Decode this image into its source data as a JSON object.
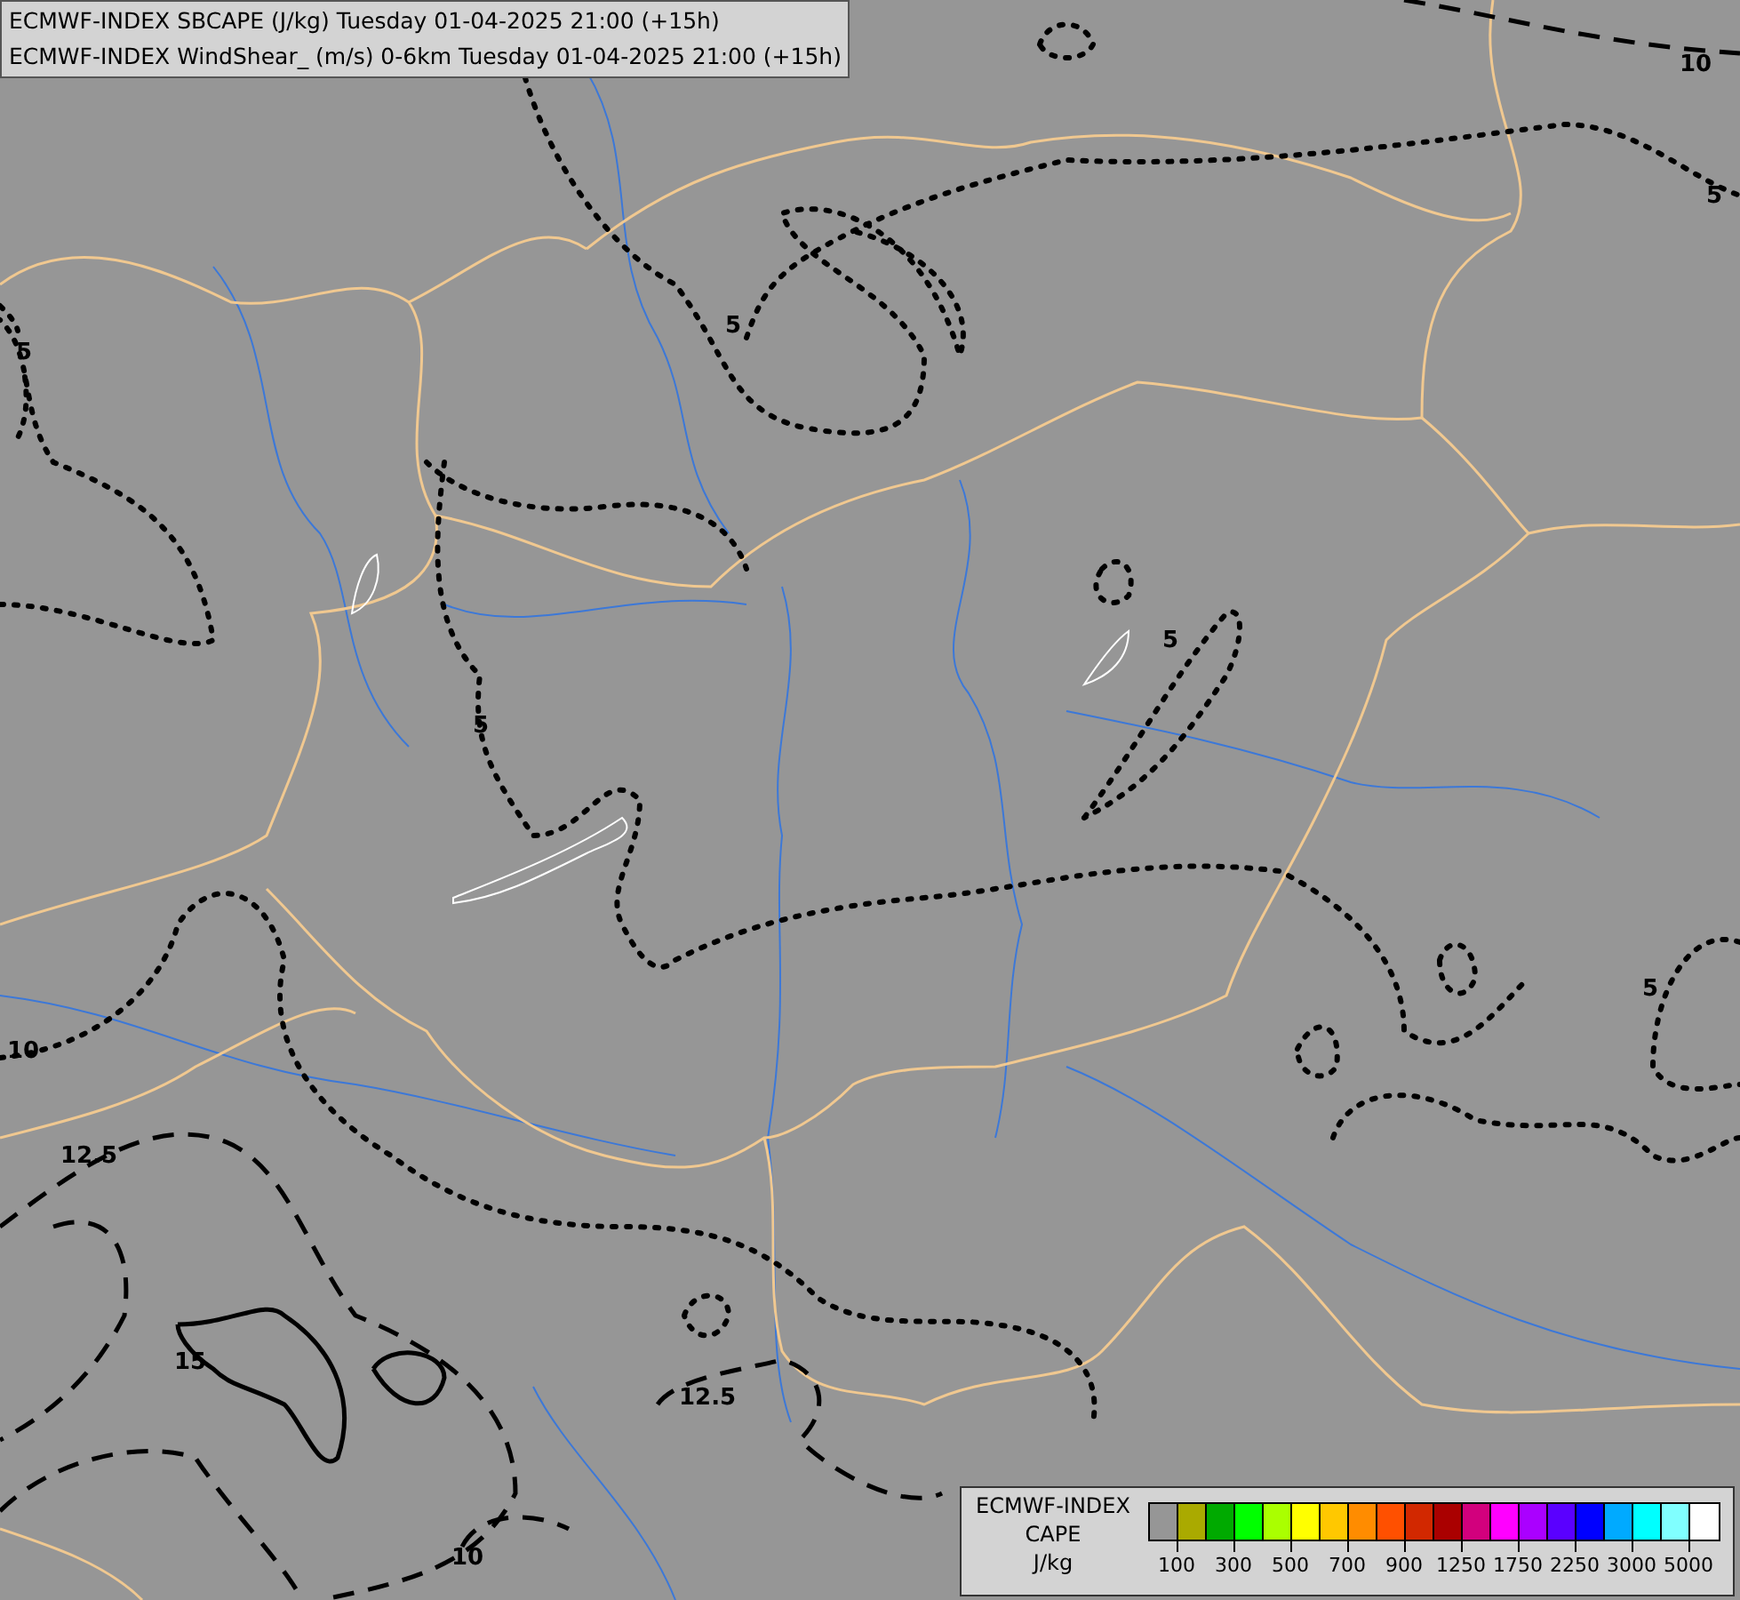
{
  "header": {
    "lines": [
      "ECMWF-INDEX SBCAPE (J/kg) Tuesday 01-04-2025 21:00 (+15h)",
      "ECMWF-INDEX WindShear_ (m/s) 0-6km Tuesday 01-04-2025 21:00 (+15h)"
    ]
  },
  "contour_labels": [
    {
      "text": "10"
    },
    {
      "text": "5"
    },
    {
      "text": "5"
    },
    {
      "text": "5"
    },
    {
      "text": "5"
    },
    {
      "text": "5"
    },
    {
      "text": "5"
    },
    {
      "text": "10"
    },
    {
      "text": "12.5"
    },
    {
      "text": "15"
    },
    {
      "text": "12.5"
    },
    {
      "text": "10"
    }
  ],
  "legend": {
    "title_lines": [
      "ECMWF-INDEX",
      "CAPE",
      "J/kg"
    ],
    "swatches": [
      {
        "color": "#969696"
      },
      {
        "color": "#aaaa00"
      },
      {
        "color": "#00aa00"
      },
      {
        "color": "#00ff00"
      },
      {
        "color": "#aaff00"
      },
      {
        "color": "#ffff00"
      },
      {
        "color": "#ffc800"
      },
      {
        "color": "#ff8c00"
      },
      {
        "color": "#ff5000"
      },
      {
        "color": "#d22800"
      },
      {
        "color": "#aa0000"
      },
      {
        "color": "#d2007d"
      },
      {
        "color": "#ff00ff"
      },
      {
        "color": "#aa00ff"
      },
      {
        "color": "#5a00ff"
      },
      {
        "color": "#0000ff"
      },
      {
        "color": "#00aaff"
      },
      {
        "color": "#00ffff"
      },
      {
        "color": "#80ffff"
      },
      {
        "color": "#ffffff"
      }
    ],
    "tick_labels": [
      "100",
      "300",
      "500",
      "700",
      "900",
      "1250",
      "1750",
      "2250",
      "3000",
      "5000"
    ]
  }
}
